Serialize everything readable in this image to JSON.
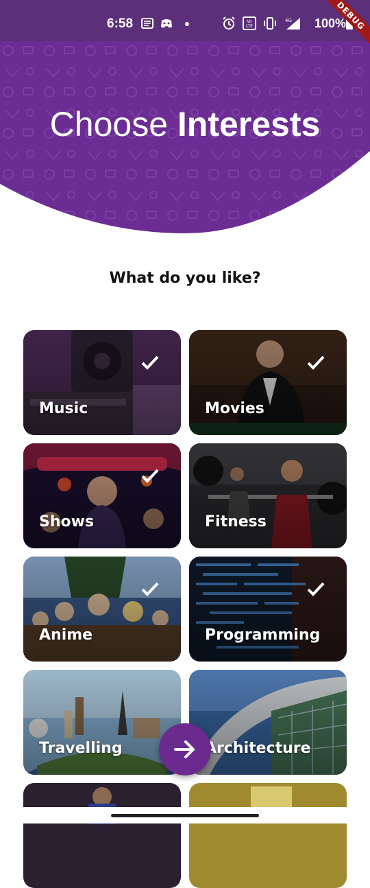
{
  "status_bar": {
    "time": "6:58",
    "battery": "100%",
    "network": "4G",
    "debug_label": "DEBUG",
    "icons": [
      "notes-icon",
      "discord-icon",
      "dot-icon",
      "alarm-icon",
      "volte-icon",
      "vibrate-icon",
      "signal-icon",
      "battery-icon"
    ]
  },
  "header": {
    "title_light": "Choose ",
    "title_bold": "Interests",
    "background_color": "#6b2d94"
  },
  "subtitle": "What do you like?",
  "interests": [
    {
      "label": "Music",
      "selected": true
    },
    {
      "label": "Movies",
      "selected": true
    },
    {
      "label": "Shows",
      "selected": true
    },
    {
      "label": "Fitness",
      "selected": false
    },
    {
      "label": "Anime",
      "selected": true
    },
    {
      "label": "Programming",
      "selected": true
    },
    {
      "label": "Travelling",
      "selected": false
    },
    {
      "label": "Architecture",
      "selected": false
    }
  ],
  "next_button": {
    "icon": "arrow-right-icon",
    "color": "#6a2a8e"
  }
}
